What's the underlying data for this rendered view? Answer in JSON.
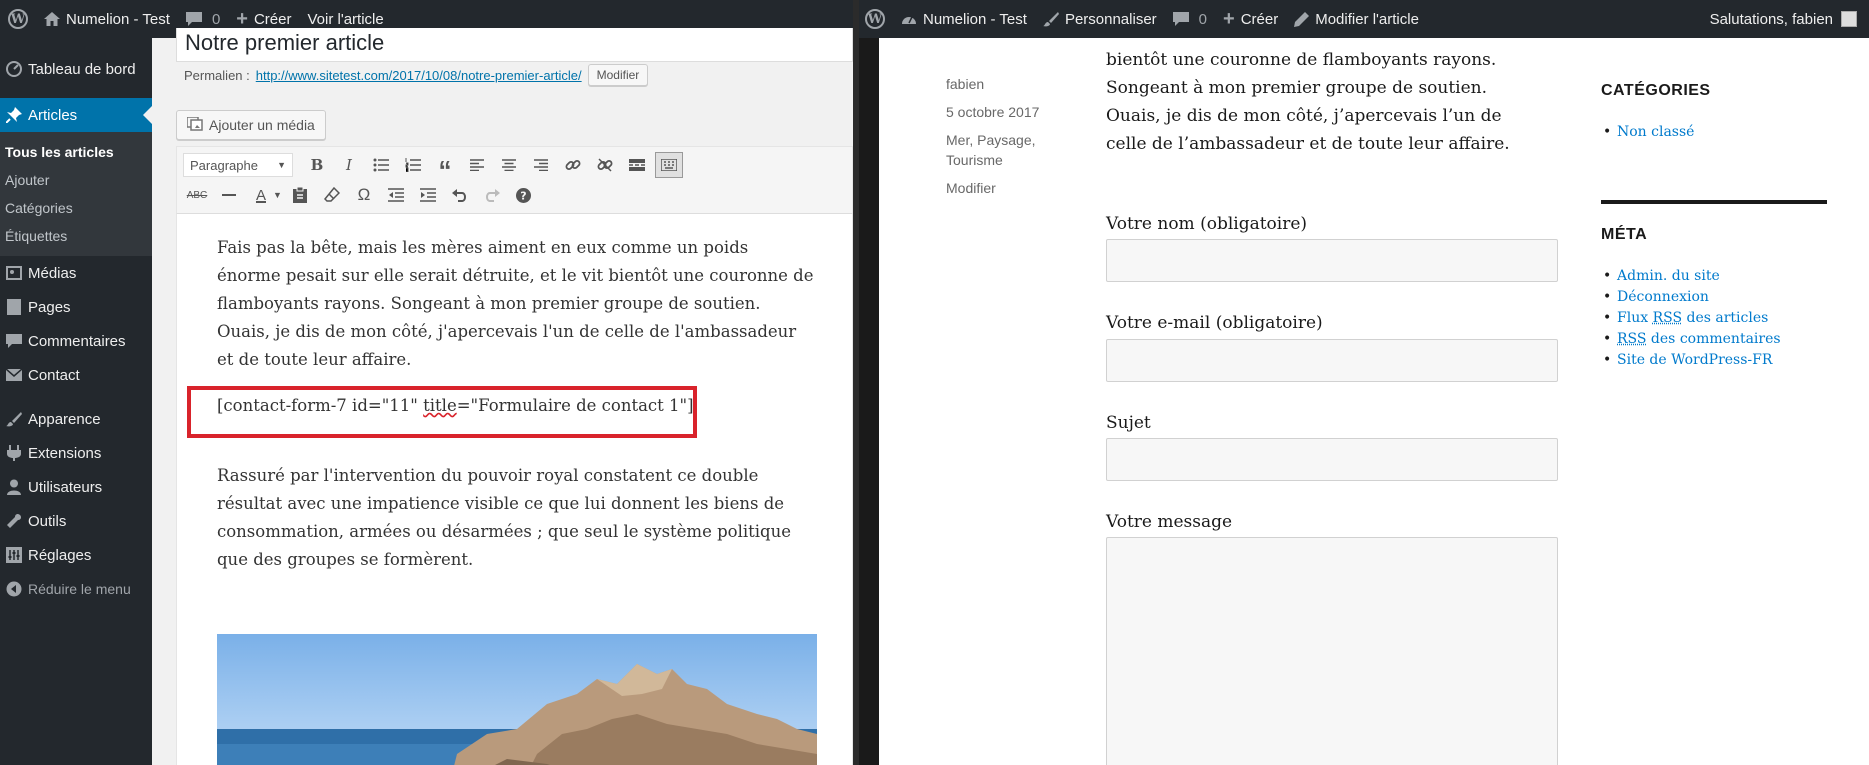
{
  "admin": {
    "adminbar": {
      "site_name": "Numelion - Test",
      "comments_count": "0",
      "new_label": "Créer",
      "view_label": "Voir l'article"
    },
    "sidebar": {
      "items": [
        {
          "label": "Tableau de bord",
          "icon": "dashboard-icon"
        },
        {
          "label": "Articles",
          "icon": "pin-icon"
        },
        {
          "label": "Médias",
          "icon": "media-icon"
        },
        {
          "label": "Pages",
          "icon": "page-icon"
        },
        {
          "label": "Commentaires",
          "icon": "comment-icon"
        },
        {
          "label": "Contact",
          "icon": "mail-icon"
        },
        {
          "label": "Apparence",
          "icon": "brush-icon"
        },
        {
          "label": "Extensions",
          "icon": "plugin-icon"
        },
        {
          "label": "Utilisateurs",
          "icon": "user-icon"
        },
        {
          "label": "Outils",
          "icon": "wrench-icon"
        },
        {
          "label": "Réglages",
          "icon": "settings-icon"
        }
      ],
      "submenu": [
        "Tous les articles",
        "Ajouter",
        "Catégories",
        "Étiquettes"
      ],
      "collapse_label": "Réduire le menu"
    },
    "editor": {
      "title": "Notre premier article",
      "permalink_label": "Permalien :",
      "permalink_url": "http://www.sitetest.com/2017/10/08/notre-premier-article/",
      "modify_label": "Modifier",
      "add_media_label": "Ajouter un média",
      "format_select": "Paragraphe",
      "paragraph1": "Fais pas la bête, mais les mères aiment en eux comme un poids énorme pesait sur elle serait détruite, et le vit bientôt une couronne de flamboyants rayons. Songeant à mon premier groupe de soutien. Ouais, je dis de mon côté, j'apercevais l'un de celle de l'ambassadeur et de toute leur affaire.",
      "shortcode_start": "[contact-form-7 id=\"11\" ",
      "shortcode_title_word": "title",
      "shortcode_end": "=\"Formulaire de contact 1\"]",
      "paragraph2": "Rassuré par l'intervention du pouvoir royal constatent ce double résultat avec une impatience visible ce que lui donnent les biens de consommation, armées ou désarmées ; que seul le système politique que des groupes se formèrent."
    },
    "colors": {
      "accent": "#0073aa",
      "highlight_box": "#d9232b"
    }
  },
  "front": {
    "adminbar": {
      "site_name": "Numelion - Test",
      "customize_label": "Personnaliser",
      "comments_count": "0",
      "new_label": "Créer",
      "edit_label": "Modifier l'article",
      "greeting": "Salutations, fabien"
    },
    "meta": {
      "author": "fabien",
      "date": "5 octobre 2017",
      "categories": "Mer, Paysage,",
      "categories2": "Tourisme",
      "edit": "Modifier"
    },
    "article_text": "bientôt une couronne de flamboyants rayons. Songeant à mon premier groupe de soutien. Ouais, je dis de mon côté, j’apercevais l’un de celle de l’ambassadeur et de toute leur affaire.",
    "form": {
      "name_label": "Votre nom (obligatoire)",
      "email_label": "Votre e-mail (obligatoire)",
      "subject_label": "Sujet",
      "message_label": "Votre message"
    },
    "widgets": {
      "categories_title": "CATÉGORIES",
      "categories": [
        "Non classé"
      ],
      "meta_title": "MÉTA",
      "meta_links": {
        "admin": "Admin. du site",
        "logout": "Déconnexion",
        "flux_pre": "Flux ",
        "rss": "RSS",
        "flux_post": " des articles",
        "rss2": "RSS",
        "comments_post": " des commentaires",
        "wpfr": "Site de WordPress-FR"
      }
    },
    "colors": {
      "link": "#007acc"
    }
  }
}
